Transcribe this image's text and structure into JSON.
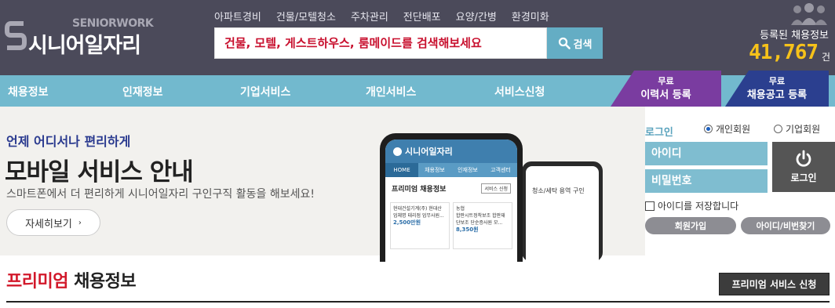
{
  "logo": {
    "en": "SENIORWORK",
    "ko": "시니어일자리"
  },
  "quick_links": [
    "아파트경비",
    "건물/모텔청소",
    "주차관리",
    "전단배포",
    "요양/간병",
    "환경미화"
  ],
  "search": {
    "placeholder": "건물, 모텔, 게스트하우스, 룸메이드를 검색해보세요",
    "button": "검색"
  },
  "stats": {
    "label": "등록된 채용정보",
    "count": "41,767",
    "unit": "건"
  },
  "nav": [
    "채용정보",
    "인재정보",
    "기업서비스",
    "개인서비스",
    "서비스신청"
  ],
  "promo": [
    {
      "small": "무료",
      "label": "이력서 등록"
    },
    {
      "small": "무료",
      "label": "채용공고 등록"
    }
  ],
  "banner": {
    "subtitle": "언제 어디서나 편리하게",
    "title": "모바일 서비스 안내",
    "desc": "스마트폰에서 더 편리하게 시니어일자리 구인구직 활동을 해보세요!",
    "more": "자세히보기"
  },
  "phone": {
    "app_title": "시니어일자리",
    "tabs": [
      "HOME",
      "채용정보",
      "인재정보",
      "고객센터"
    ],
    "premium": "프리미엄 채용정보",
    "svc": "서비스 신청",
    "cards": [
      {
        "company": "현대건설기계(주) 현대산",
        "title": "업체명 태리점 업무사원...",
        "salary": "2,500만원"
      },
      {
        "company": "농협",
        "title": "합판시트정착보조 합판재 단보조 단순증사원 모...",
        "salary": "8,350원"
      }
    ],
    "back_title": "청소/세탁 용역 구인"
  },
  "login": {
    "title": "로그인",
    "radio_personal": "개인회원",
    "radio_company": "기업회원",
    "id_placeholder": "아이디",
    "pw_placeholder": "비밀번호",
    "button": "로그인",
    "save_id": "아이디를 저장합니다",
    "join": "회원가입",
    "find": "아이디/비번찾기"
  },
  "premium_section": {
    "title_red": "프리미엄",
    "title_rest": " 채용정보",
    "button": "프리미엄 서비스 신청"
  }
}
